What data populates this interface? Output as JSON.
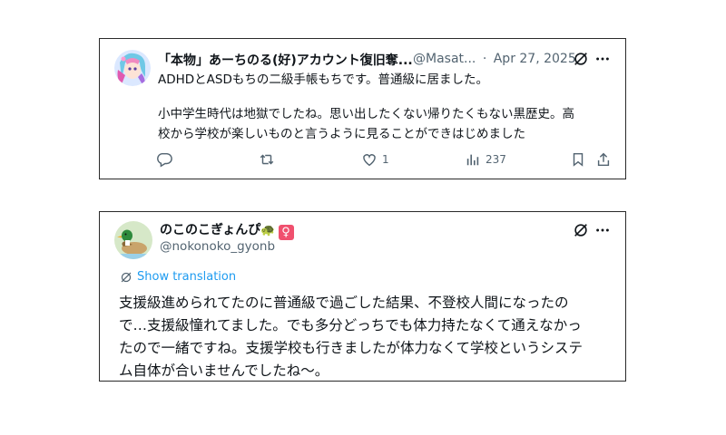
{
  "tweet1": {
    "display_name": "「本物」あーちのる(好)アカウント復旧奪...",
    "handle": "@Masat...",
    "separator": "·",
    "date": "Apr 27, 2025",
    "line1": "ADHDとASDもちの二級手帳もちです。普通級に居ました。",
    "line2": "小中学生時代は地獄でしたね。思い出したくない帰りたくもない黒歴史。高",
    "line3": "校から学校が楽しいものと言うように見ることができはじめました",
    "likes": "1",
    "views": "237",
    "icons": [
      "grok-icon",
      "more-icon",
      "reply-icon",
      "retweet-icon",
      "like-icon",
      "views-icon",
      "bookmark-icon",
      "share-icon"
    ]
  },
  "tweet2": {
    "display_name": "のこのこぎょんぴ",
    "emoji": "🐢",
    "badge": "♀",
    "handle": "@nokonoko_gyonb",
    "show_translation": "Show translation",
    "line1": "支援級進められてたのに普通級で過ごした結果、不登校人間になったの",
    "line2": "で…支援級憧れてました。でも多分どっちでも体力持たなくて通えなかっ",
    "line3": "たので一緒ですね。支援学校も行きましたが体力なくて学校というシステ",
    "line4": "ム自体が合いませんでしたね〜。",
    "icons": [
      "grok-icon",
      "more-icon",
      "translate-icon"
    ]
  },
  "colors": {
    "accent": "#1d9bf0",
    "muted": "#536471",
    "text": "#0f1419",
    "badge": "#f0506e"
  }
}
